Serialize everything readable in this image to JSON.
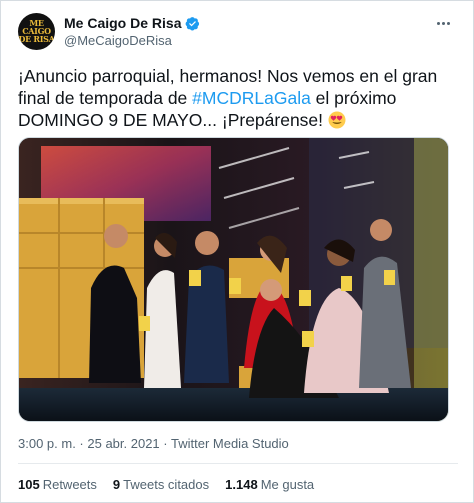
{
  "account": {
    "display_name": "Me Caigo De Risa",
    "handle": "@MeCaigoDeRisa",
    "verified": true,
    "avatar_logo_lines": [
      "ME",
      "CAIGO",
      "DE RISA"
    ]
  },
  "tweet": {
    "text_before": "¡Anuncio parroquial, hermanos! Nos vemos en el gran final de temporada de ",
    "hashtag": "#MCDRLaGala",
    "text_after": " el próximo DOMINGO 9 DE MAYO... ¡Prepárense! ",
    "emoji_icon": "heart-eyes-emoji"
  },
  "meta": {
    "time": "3:00 p. m.",
    "separator": " · ",
    "date": "25 abr. 2021",
    "source": "Twitter Media Studio"
  },
  "stats": [
    {
      "count": "105",
      "label": "Retweets"
    },
    {
      "count": "9",
      "label": "Tweets citados"
    },
    {
      "count": "1.148",
      "label": "Me gusta"
    }
  ],
  "colors": {
    "accent": "#1d9bf0",
    "text_primary": "#0f1419",
    "text_secondary": "#536471",
    "seat_gold": "#d9a43a"
  }
}
